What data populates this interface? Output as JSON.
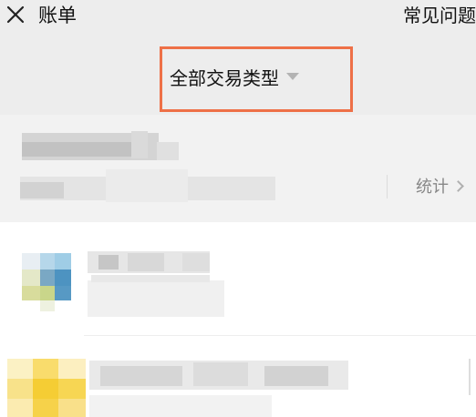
{
  "header": {
    "title": "账单",
    "help_link": "常见问题"
  },
  "filter": {
    "label": "全部交易类型",
    "highlight_color": "#ee7047"
  },
  "summary": {
    "stats_label": "统计"
  },
  "colors": {
    "background": "#ededed",
    "card": "#f2f2f2",
    "muted_text": "#888888"
  },
  "icons": [
    "close-icon",
    "dropdown-caret-icon",
    "chevron-right-icon"
  ]
}
